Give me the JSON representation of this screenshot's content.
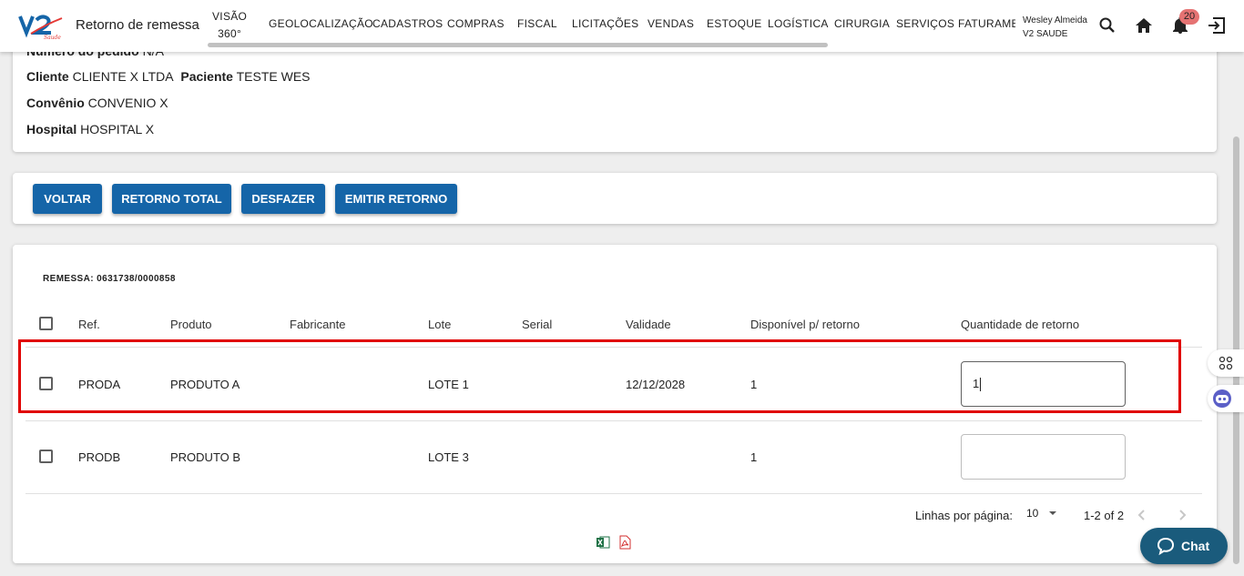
{
  "header": {
    "title": "Retorno de remessa",
    "nav": [
      {
        "line1": "VISÃO",
        "line2": "360°"
      },
      {
        "label": "GEOLOCALIZAÇÃO"
      },
      {
        "label": "CADASTROS"
      },
      {
        "label": "COMPRAS"
      },
      {
        "label": "FISCAL"
      },
      {
        "label": "LICITAÇÕES"
      },
      {
        "label": "VENDAS"
      },
      {
        "label": "ESTOQUE"
      },
      {
        "label": "LOGÍSTICA"
      },
      {
        "label": "CIRURGIA"
      },
      {
        "label": "SERVIÇOS"
      },
      {
        "label": "FATURAMENTO"
      }
    ],
    "user_name": "Wesley Almeida",
    "user_company": "V2 SAUDE",
    "notification_count": "20",
    "icons": [
      "search-icon",
      "home-icon",
      "bell-icon",
      "logout-icon"
    ]
  },
  "info": {
    "pedido_label": "Número do pedido",
    "pedido_value": "N/A",
    "cliente_label": "Cliente",
    "cliente_value": "CLIENTE X LTDA",
    "paciente_label": "Paciente",
    "paciente_value": "TESTE WES",
    "convenio_label": "Convênio",
    "convenio_value": "CONVENIO X",
    "hospital_label": "Hospital",
    "hospital_value": "HOSPITAL X"
  },
  "actions": {
    "voltar": "VOLTAR",
    "retorno_total": "RETORNO TOTAL",
    "desfazer": "DESFAZER",
    "emitir_retorno": "EMITIR RETORNO"
  },
  "table": {
    "remessa": "REMESSA: 0631738/0000858",
    "headers": {
      "ref": "Ref.",
      "produto": "Produto",
      "fabricante": "Fabricante",
      "lote": "Lote",
      "serial": "Serial",
      "validade": "Validade",
      "disponivel": "Disponível p/ retorno",
      "quantidade": "Quantidade de retorno"
    },
    "rows": [
      {
        "ref": "PRODA",
        "produto": "PRODUTO A",
        "fabricante": "",
        "lote": "LOTE 1",
        "serial": "",
        "validade": "12/12/2028",
        "disponivel": "1",
        "quantidade": "1"
      },
      {
        "ref": "PRODB",
        "produto": "PRODUTO B",
        "fabricante": "",
        "lote": "LOTE 3",
        "serial": "",
        "validade": "",
        "disponivel": "1",
        "quantidade": ""
      }
    ],
    "rows_per_page_label": "Linhas por página:",
    "rows_per_page_value": "10",
    "range": "1-2 of 2"
  },
  "chat_label": "Chat",
  "colors": {
    "primary_button": "#1565a8",
    "highlight": "#e00000",
    "badge": "#e57373",
    "chat": "#1a5b7c"
  }
}
